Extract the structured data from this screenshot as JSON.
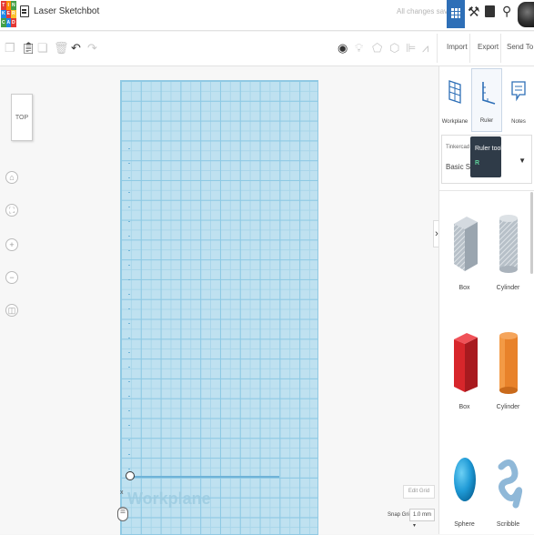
{
  "header": {
    "logo_letters": [
      "T",
      "I",
      "N",
      "K",
      "E",
      "R",
      "C",
      "A",
      "D"
    ],
    "logo_colors": [
      "#e53935",
      "#fb8c00",
      "#43a047",
      "#1e88e5",
      "#e53935",
      "#fbc02d",
      "#43a047",
      "#1e88e5",
      "#e53935"
    ],
    "project_title": "Laser Sketchbot",
    "save_status": "All changes saved"
  },
  "toolbar": {
    "import_label": "Import",
    "export_label": "Export",
    "send_to_label": "Send To"
  },
  "viewcube": {
    "label": "TOP"
  },
  "workplane": {
    "label": "Workplane",
    "axis_label": "x",
    "edit_grid_label": "Edit Grid",
    "snap_grid_label": "Snap Grid",
    "snap_grid_value": "1.0 mm"
  },
  "panel": {
    "tabs": [
      {
        "label": "Workplane"
      },
      {
        "label": "Ruler"
      },
      {
        "label": "Notes"
      }
    ],
    "library_source": "Tinkercad",
    "library_selected": "Basic Shapes",
    "tooltip_title": "Ruler tool",
    "tooltip_shortcut": "R",
    "shapes": [
      {
        "label": "Box",
        "color": "#a9b3bd"
      },
      {
        "label": "Cylinder",
        "color": "#a9b3bd"
      },
      {
        "label": "Box",
        "color": "#d7262b"
      },
      {
        "label": "Cylinder",
        "color": "#e8822a"
      },
      {
        "label": "Sphere",
        "color": "#1f9ad6"
      },
      {
        "label": "Scribble",
        "color": "#8fb8d8"
      }
    ]
  }
}
